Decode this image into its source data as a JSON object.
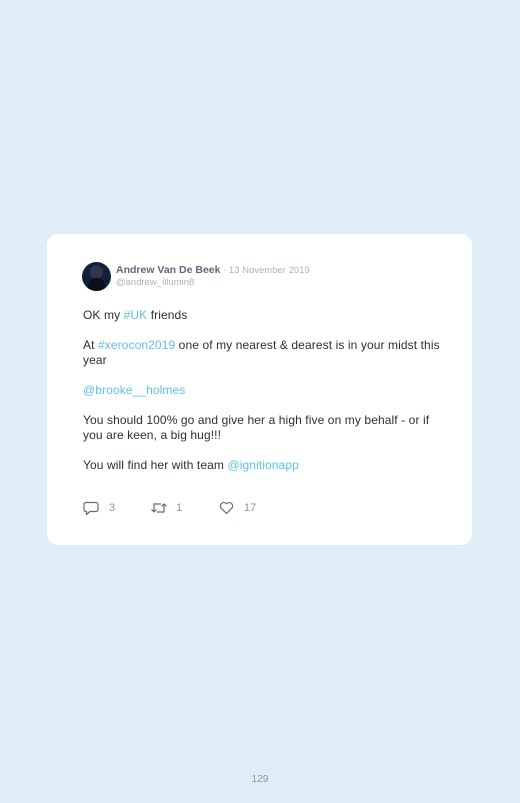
{
  "tweet": {
    "author_name": "Andrew Van De Beek",
    "separator": " · ",
    "date": "13 November 2019",
    "handle": "@andrew_illumin8",
    "paragraphs": {
      "p1": {
        "pre": "OK my ",
        "hashtag": "#UK",
        "post": " friends"
      },
      "p2": {
        "pre": "At ",
        "hashtag": "#xerocon2019",
        "post": " one of my nearest & dearest is in your midst this year"
      },
      "p3": {
        "mention": "@brooke__holmes"
      },
      "p4": {
        "text": "You should 100% go and give her a high five on my behalf - or if you are keen, a big hug!!!"
      },
      "p5": {
        "pre": "You will find her with team ",
        "mention": "@ignitionapp"
      }
    },
    "actions": {
      "reply_icon": "reply-icon",
      "reply_count": "3",
      "retweet_icon": "retweet-icon",
      "retweet_count": "1",
      "like_icon": "heart-icon",
      "like_count": "17"
    }
  },
  "page": {
    "number": "129"
  },
  "colors": {
    "background": "#dfedf6",
    "card": "#ffffff",
    "link": "#5fc0e6",
    "muted": "#a9b3bd",
    "text": "#2b2f36"
  }
}
